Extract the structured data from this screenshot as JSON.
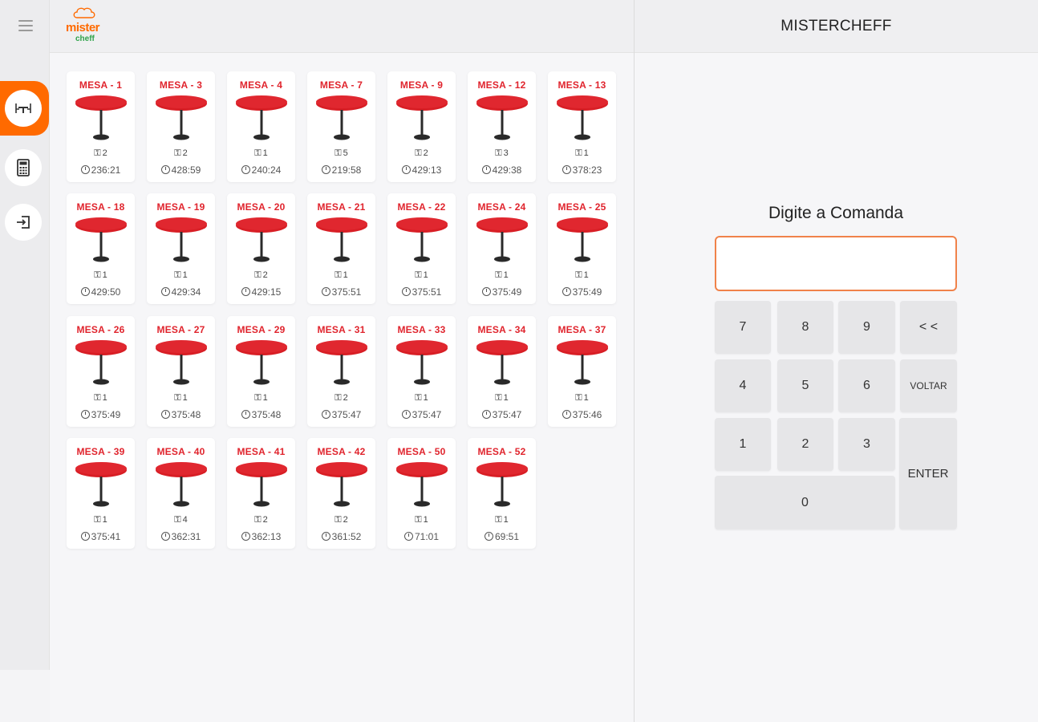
{
  "sidebar": {
    "items": [
      {
        "icon": "table-icon",
        "active": true
      },
      {
        "icon": "calculator-icon",
        "active": false
      },
      {
        "icon": "logout-icon",
        "active": false
      }
    ]
  },
  "brand": {
    "logo_line1": "mister",
    "logo_line2": "cheff",
    "accent": "#ff6a00",
    "green": "#2fa34a"
  },
  "tables": [
    {
      "label": "MESA - 1",
      "people": "2",
      "time": "236:21"
    },
    {
      "label": "MESA - 3",
      "people": "2",
      "time": "428:59"
    },
    {
      "label": "MESA - 4",
      "people": "1",
      "time": "240:24"
    },
    {
      "label": "MESA - 7",
      "people": "5",
      "time": "219:58"
    },
    {
      "label": "MESA - 9",
      "people": "2",
      "time": "429:13"
    },
    {
      "label": "MESA - 12",
      "people": "3",
      "time": "429:38"
    },
    {
      "label": "MESA - 13",
      "people": "1",
      "time": "378:23"
    },
    {
      "label": "MESA - 18",
      "people": "1",
      "time": "429:50"
    },
    {
      "label": "MESA - 19",
      "people": "1",
      "time": "429:34"
    },
    {
      "label": "MESA - 20",
      "people": "2",
      "time": "429:15"
    },
    {
      "label": "MESA - 21",
      "people": "1",
      "time": "375:51"
    },
    {
      "label": "MESA - 22",
      "people": "1",
      "time": "375:51"
    },
    {
      "label": "MESA - 24",
      "people": "1",
      "time": "375:49"
    },
    {
      "label": "MESA - 25",
      "people": "1",
      "time": "375:49"
    },
    {
      "label": "MESA - 26",
      "people": "1",
      "time": "375:49"
    },
    {
      "label": "MESA - 27",
      "people": "1",
      "time": "375:48"
    },
    {
      "label": "MESA - 29",
      "people": "1",
      "time": "375:48"
    },
    {
      "label": "MESA - 31",
      "people": "2",
      "time": "375:47"
    },
    {
      "label": "MESA - 33",
      "people": "1",
      "time": "375:47"
    },
    {
      "label": "MESA - 34",
      "people": "1",
      "time": "375:47"
    },
    {
      "label": "MESA - 37",
      "people": "1",
      "time": "375:46"
    },
    {
      "label": "MESA - 39",
      "people": "1",
      "time": "375:41"
    },
    {
      "label": "MESA - 40",
      "people": "4",
      "time": "362:31"
    },
    {
      "label": "MESA - 41",
      "people": "2",
      "time": "362:13"
    },
    {
      "label": "MESA - 42",
      "people": "2",
      "time": "361:52"
    },
    {
      "label": "MESA - 50",
      "people": "1",
      "time": "71:01"
    },
    {
      "label": "MESA - 52",
      "people": "1",
      "time": "69:51"
    }
  ],
  "right_panel": {
    "title": "MISTERCHEFF",
    "prompt": "Digite a Comanda",
    "input_value": "",
    "keys": [
      {
        "label": "7",
        "key": "7"
      },
      {
        "label": "8",
        "key": "8"
      },
      {
        "label": "9",
        "key": "9"
      },
      {
        "label": "< <",
        "key": "backspace"
      },
      {
        "label": "4",
        "key": "4"
      },
      {
        "label": "5",
        "key": "5"
      },
      {
        "label": "6",
        "key": "6"
      },
      {
        "label": "VOLTAR",
        "key": "voltar"
      },
      {
        "label": "1",
        "key": "1"
      },
      {
        "label": "2",
        "key": "2"
      },
      {
        "label": "3",
        "key": "3"
      },
      {
        "label": "ENTER",
        "key": "enter"
      },
      {
        "label": "0",
        "key": "0"
      }
    ]
  },
  "colors": {
    "table_top": "#d81e25",
    "table_leg": "#2a2a2a",
    "card_title": "#e0242d",
    "input_border": "#f0824a"
  }
}
